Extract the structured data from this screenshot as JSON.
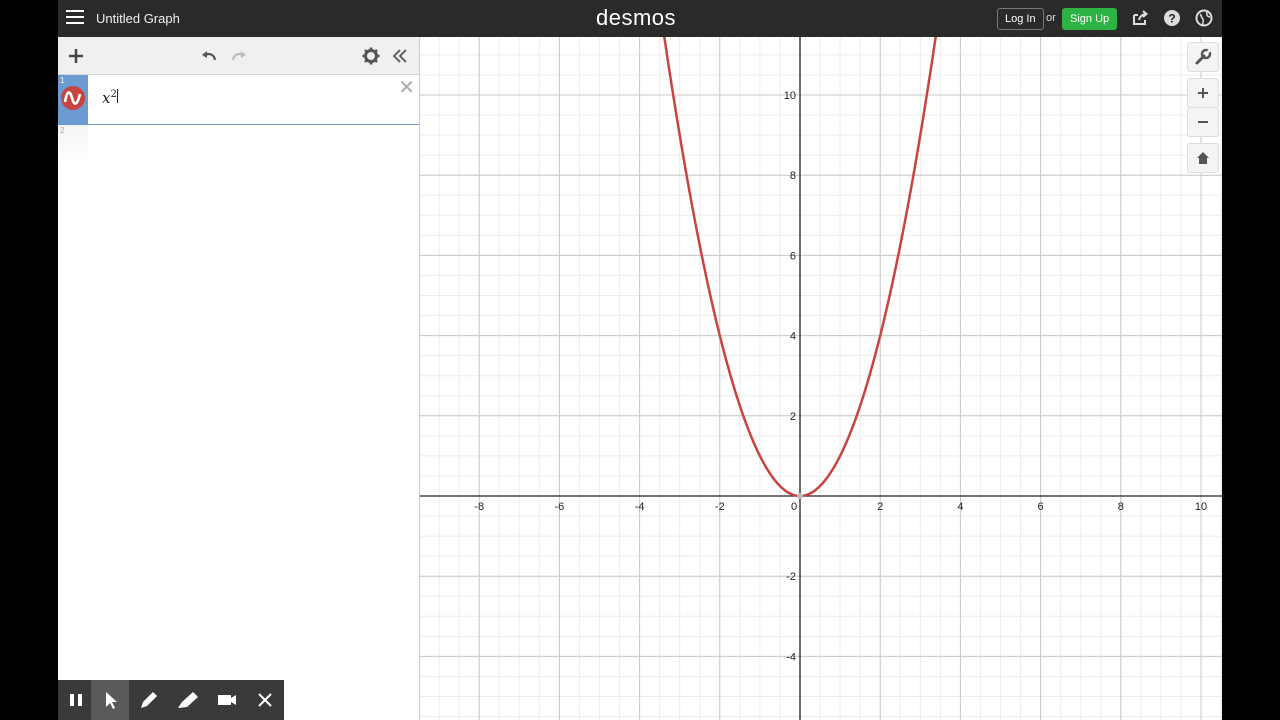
{
  "header": {
    "title": "Untitled Graph",
    "brand": "desmos",
    "login_label": "Log In",
    "or_label": "or",
    "signup_label": "Sign Up"
  },
  "toolbar": {
    "icons": [
      "plus-icon",
      "undo-icon",
      "redo-icon",
      "gear-icon",
      "collapse-icon"
    ]
  },
  "expressions": [
    {
      "index": "1",
      "latex_base": "x",
      "latex_exp": "2",
      "color": "#c74440"
    },
    {
      "index": "2",
      "latex_base": "",
      "latex_exp": ""
    }
  ],
  "graph": {
    "x_ticks": [
      "-8",
      "-6",
      "-4",
      "-2",
      "0",
      "2",
      "4",
      "6",
      "8",
      "10"
    ],
    "y_ticks": [
      "10",
      "8",
      "6",
      "4",
      "2",
      "-2",
      "-4"
    ],
    "curve_color": "#c74440",
    "function": "x^2",
    "controls": [
      "wrench-icon",
      "zoom-in-icon",
      "zoom-out-icon",
      "home-icon"
    ]
  },
  "bottom_toolbar": {
    "icons": [
      "pause-icon",
      "pointer-icon",
      "pen-icon",
      "highlighter-icon",
      "camera-icon",
      "close-icon"
    ]
  }
}
